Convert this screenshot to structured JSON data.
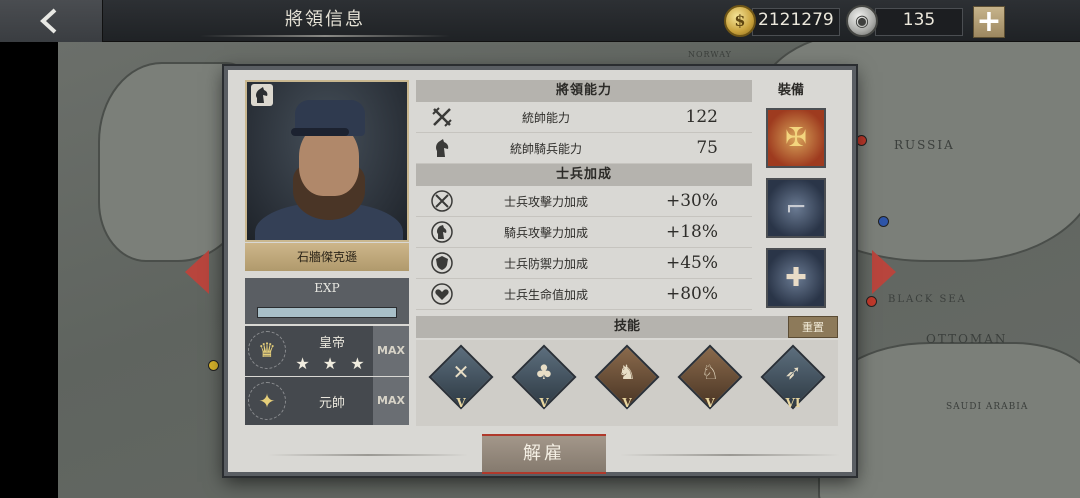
{
  "topbar": {
    "title": "將領信息",
    "gold": "2121279",
    "silver": "135",
    "add_label": "+"
  },
  "map": {
    "labels": [
      "RUSSIA",
      "BLACK SEA",
      "OTTOMAN",
      "SAUDI ARABIA",
      "NORWAY"
    ]
  },
  "general": {
    "name": "石牆傑克遜",
    "exp_label": "EXP",
    "exp_progress": 1.0,
    "ranks": [
      {
        "title": "皇帝",
        "stars": "★ ★ ★",
        "max": "MAX",
        "icon": "crown-icon"
      },
      {
        "title": "元帥",
        "stars": "",
        "max": "MAX",
        "icon": "eagle-icon"
      }
    ]
  },
  "abilities": {
    "header": "將領能力",
    "rows": [
      {
        "label": "統帥能力",
        "value": "122",
        "icon": "crossed-swords-icon"
      },
      {
        "label": "統帥騎兵能力",
        "value": "75",
        "icon": "horse-head-icon"
      }
    ]
  },
  "bonus": {
    "header": "士兵加成",
    "rows": [
      {
        "label": "士兵攻擊力加成",
        "value": "+30%",
        "icon": "swords-plus-icon"
      },
      {
        "label": "騎兵攻擊力加成",
        "value": "+18%",
        "icon": "horse-plus-icon"
      },
      {
        "label": "士兵防禦力加成",
        "value": "+45%",
        "icon": "shield-plus-icon"
      },
      {
        "label": "士兵生命值加成",
        "value": "+80%",
        "icon": "heart-plus-icon"
      }
    ]
  },
  "equipment": {
    "header": "裝備",
    "items": [
      "medal-box-icon",
      "pistol-icon",
      "medical-cart-icon"
    ]
  },
  "skills": {
    "header": "技能",
    "reset_label": "重置",
    "items": [
      {
        "icon": "cannon-icon",
        "level": "V"
      },
      {
        "icon": "forest-icon",
        "level": "V"
      },
      {
        "icon": "cavalry-icon",
        "level": "V"
      },
      {
        "icon": "horse-rider-icon",
        "level": "V"
      },
      {
        "icon": "lance-icon",
        "level": "VI"
      }
    ]
  },
  "actions": {
    "dismiss_label": "解雇"
  },
  "colors": {
    "panel_bg": "#d9d8d4",
    "accent_gold": "#cdb68a",
    "nav_arrow": "#b8453d",
    "dismiss_border": "#b0392b"
  }
}
